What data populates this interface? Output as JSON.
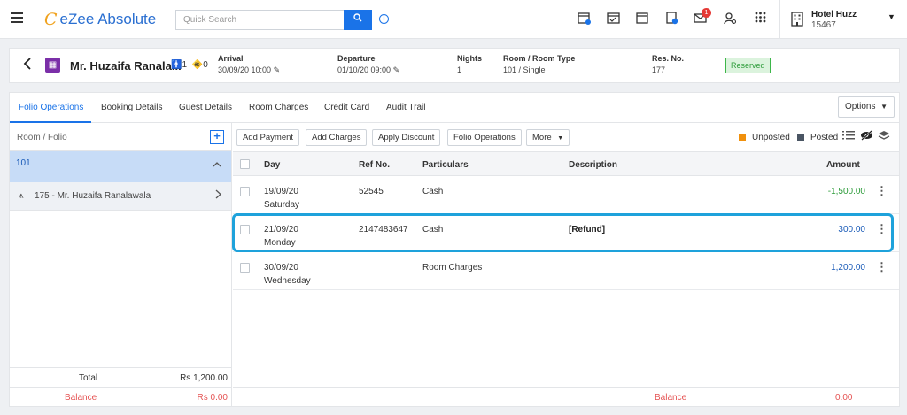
{
  "app": {
    "logo_mark": "C",
    "name": "eZee Absolute"
  },
  "search": {
    "placeholder": "Quick Search",
    "button_icon": "search-icon"
  },
  "hotel": {
    "name": "Hotel Huzz",
    "code": "15467"
  },
  "notifications": {
    "count": "1"
  },
  "reservation": {
    "guest_name": "Mr. Huzaifa Ranala...",
    "adults": "1",
    "children": "0",
    "arrival_label": "Arrival",
    "arrival_value": "30/09/20 10:00",
    "departure_label": "Departure",
    "departure_value": "01/10/20 09:00",
    "nights_label": "Nights",
    "nights_value": "1",
    "room_type_label": "Room / Room Type",
    "room_type_value": "101 / Single",
    "res_no_label": "Res. No.",
    "res_no_value": "177",
    "status": "Reserved"
  },
  "tabs": [
    "Folio Operations",
    "Booking Details",
    "Guest Details",
    "Room Charges",
    "Credit Card",
    "Audit Trail"
  ],
  "options_label": "Options",
  "left": {
    "header": "Room / Folio",
    "room": "101",
    "folio": "175 - Mr. Huzaifa Ranalawala",
    "total_label": "Total",
    "total_value": "Rs 1,200.00",
    "balance_label": "Balance",
    "balance_value": "Rs 0.00"
  },
  "toolbar": {
    "add_payment": "Add Payment",
    "add_charges": "Add Charges",
    "apply_discount": "Apply Discount",
    "folio_operations": "Folio Operations",
    "more": "More",
    "unposted": "Unposted",
    "posted": "Posted"
  },
  "table": {
    "headers": {
      "day": "Day",
      "ref": "Ref No.",
      "particulars": "Particulars",
      "description": "Description",
      "amount": "Amount"
    },
    "rows": [
      {
        "date": "19/09/20",
        "weekday": "Saturday",
        "ref": "52545",
        "particulars": "Cash",
        "description": "",
        "amount": "-1,500.00"
      },
      {
        "date": "21/09/20",
        "weekday": "Monday",
        "ref": "2147483647",
        "particulars": "Cash",
        "description": "[Refund]",
        "amount": "300.00"
      },
      {
        "date": "30/09/20",
        "weekday": "Wednesday",
        "ref": "",
        "particulars": "Room Charges",
        "description": "",
        "amount": "1,200.00"
      }
    ],
    "balance_label": "Balance",
    "balance_value": "0.00"
  },
  "colors": {
    "accent": "#1a73e8",
    "unposted": "#f0900c",
    "posted": "#4a5563",
    "negative": "#2e9c3b",
    "positive": "#1a5bb8",
    "balance": "#e55353",
    "highlight": "#1ea2db"
  }
}
